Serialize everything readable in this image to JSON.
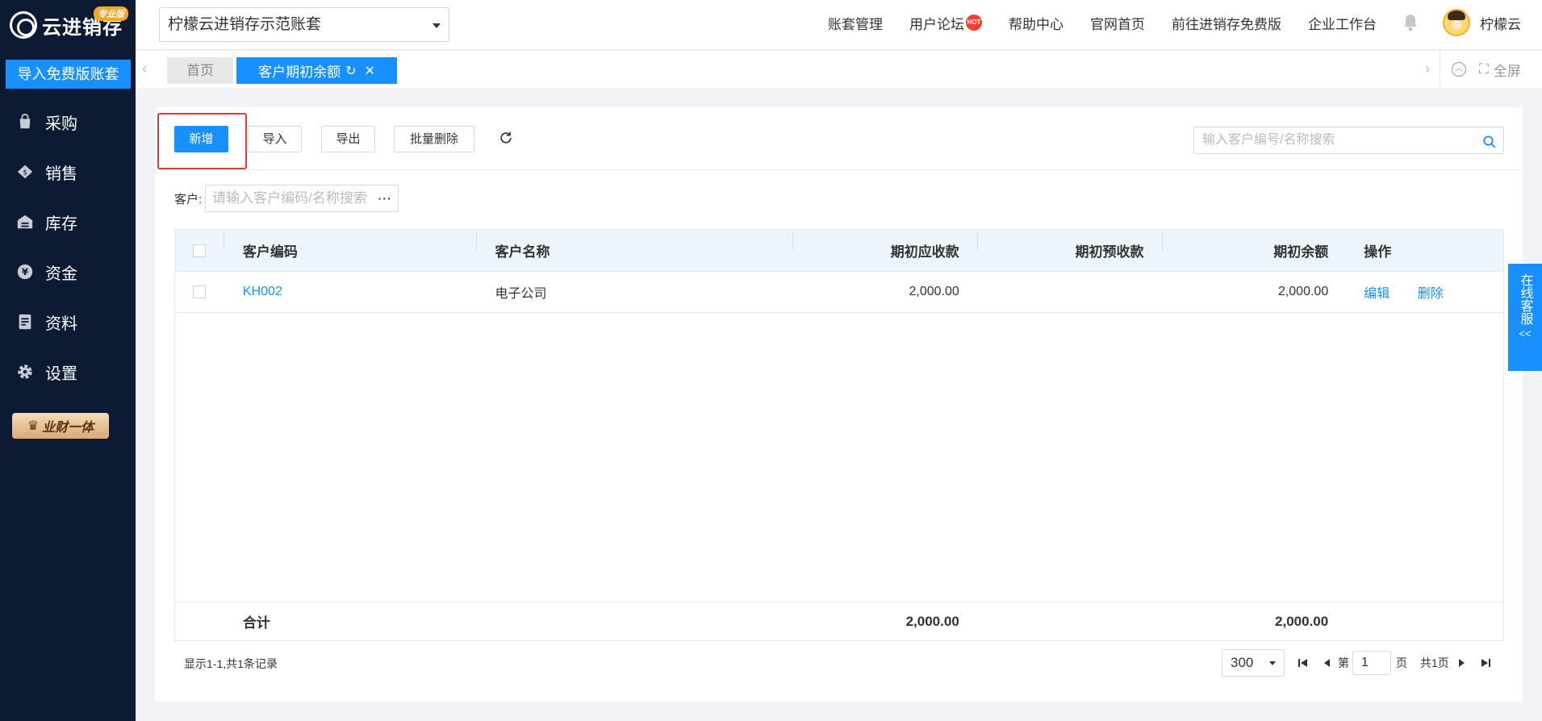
{
  "brand": {
    "name": "云进销存",
    "badge": "专业版"
  },
  "sidebar": {
    "import_label": "导入免费版账套",
    "items": [
      {
        "label": "采购",
        "icon": "bag-icon"
      },
      {
        "label": "销售",
        "icon": "tag-icon"
      },
      {
        "label": "库存",
        "icon": "warehouse-icon"
      },
      {
        "label": "资金",
        "icon": "yen-icon"
      },
      {
        "label": "资料",
        "icon": "document-icon"
      },
      {
        "label": "设置",
        "icon": "gear-icon"
      }
    ],
    "vip_label": "业财一体"
  },
  "header": {
    "account": "柠檬云进销存示范账套",
    "links": [
      "账套管理",
      "用户论坛",
      "帮助中心",
      "官网首页",
      "前往进销存免费版",
      "企业工作台"
    ],
    "hot_badge": "HOT",
    "user": "柠檬云"
  },
  "tabs": {
    "home": "首页",
    "active": "客户期初余额",
    "fullscreen": "全屏"
  },
  "toolbar": {
    "new": "新增",
    "import": "导入",
    "export": "导出",
    "batch_delete": "批量删除",
    "search_placeholder": "输入客户编号/名称搜索"
  },
  "filter": {
    "label": "客户:",
    "placeholder": "请输入客户编码/名称搜索",
    "more": "···"
  },
  "table": {
    "headers": {
      "code": "客户编码",
      "name": "客户名称",
      "receivable": "期初应收款",
      "prepaid": "期初预收款",
      "balance": "期初余额",
      "ops": "操作"
    },
    "rows": [
      {
        "code": "KH002",
        "name": "电子公司",
        "receivable": "2,000.00",
        "prepaid": "",
        "balance": "2,000.00",
        "edit": "编辑",
        "delete": "删除"
      }
    ],
    "footer": {
      "label": "合计",
      "receivable": "2,000.00",
      "balance": "2,000.00"
    }
  },
  "pagination": {
    "records": "显示1-1,共1条记录",
    "page_size": "300",
    "page_prefix": "第",
    "page": "1",
    "page_suffix": "页",
    "total_pages": "共1页"
  },
  "service": {
    "label": "在线客服",
    "arrow": "<<"
  },
  "colors": {
    "sidebar": "#0c1a33",
    "primary": "#1890ff",
    "highlight": "#e53935"
  }
}
